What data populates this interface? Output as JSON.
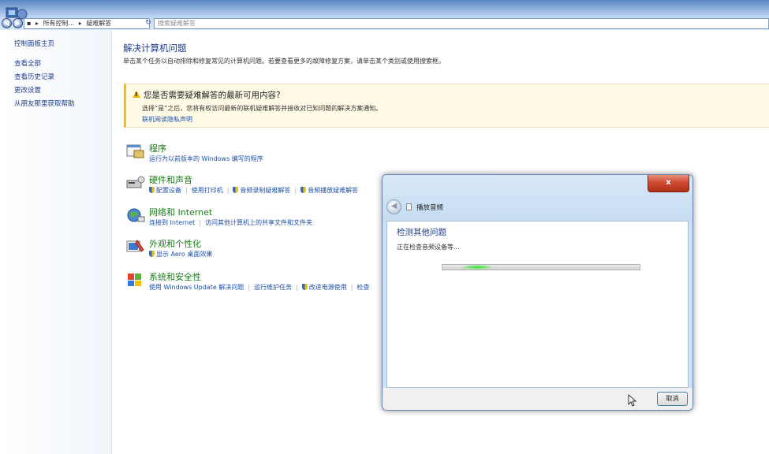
{
  "address_bar": {
    "crumb1": "所有控制...",
    "crumb2": "疑难解答",
    "search_placeholder": "搜索疑难解答"
  },
  "sidebar": {
    "items": [
      {
        "label": "控制面板主页"
      },
      {
        "label": "查看全部"
      },
      {
        "label": "查看历史记录"
      },
      {
        "label": "更改设置"
      },
      {
        "label": "从朋友那里获取帮助"
      }
    ]
  },
  "main": {
    "title": "解决计算机问题",
    "description": "单击某个任务以自动排除和修复常见的计算机问题。若要查看更多的故障修复方案，请单击某个类别或使用搜索框。",
    "notice": {
      "title": "您是否需要疑难解答的最新可用内容?",
      "text": "选择“是”之后，您将有权访问最新的联机疑难解答并接收对已知问题的解决方案通知。",
      "link": "联机阅读隐私声明"
    },
    "categories": [
      {
        "title": "程序",
        "links": [
          "运行为以前版本的 Windows 编写的程序"
        ]
      },
      {
        "title": "硬件和声音",
        "links": [
          "配置设备",
          "使用打印机",
          "音频录制疑难解答",
          "音频播放疑难解答"
        ]
      },
      {
        "title": "网络和 Internet",
        "links": [
          "连接到 Internet",
          "访问其他计算机上的共享文件和文件夹"
        ]
      },
      {
        "title": "外观和个性化",
        "links": [
          "显示 Aero 桌面效果"
        ]
      },
      {
        "title": "系统和安全性",
        "links": [
          "使用 Windows Update 解决问题",
          "运行维护任务",
          "改进电源使用",
          "检查"
        ]
      }
    ]
  },
  "dialog": {
    "header_title": "播放音频",
    "close_label": "x",
    "heading": "检测其他问题",
    "status": "正在检查音频设备等...",
    "cancel_label": "取消"
  }
}
